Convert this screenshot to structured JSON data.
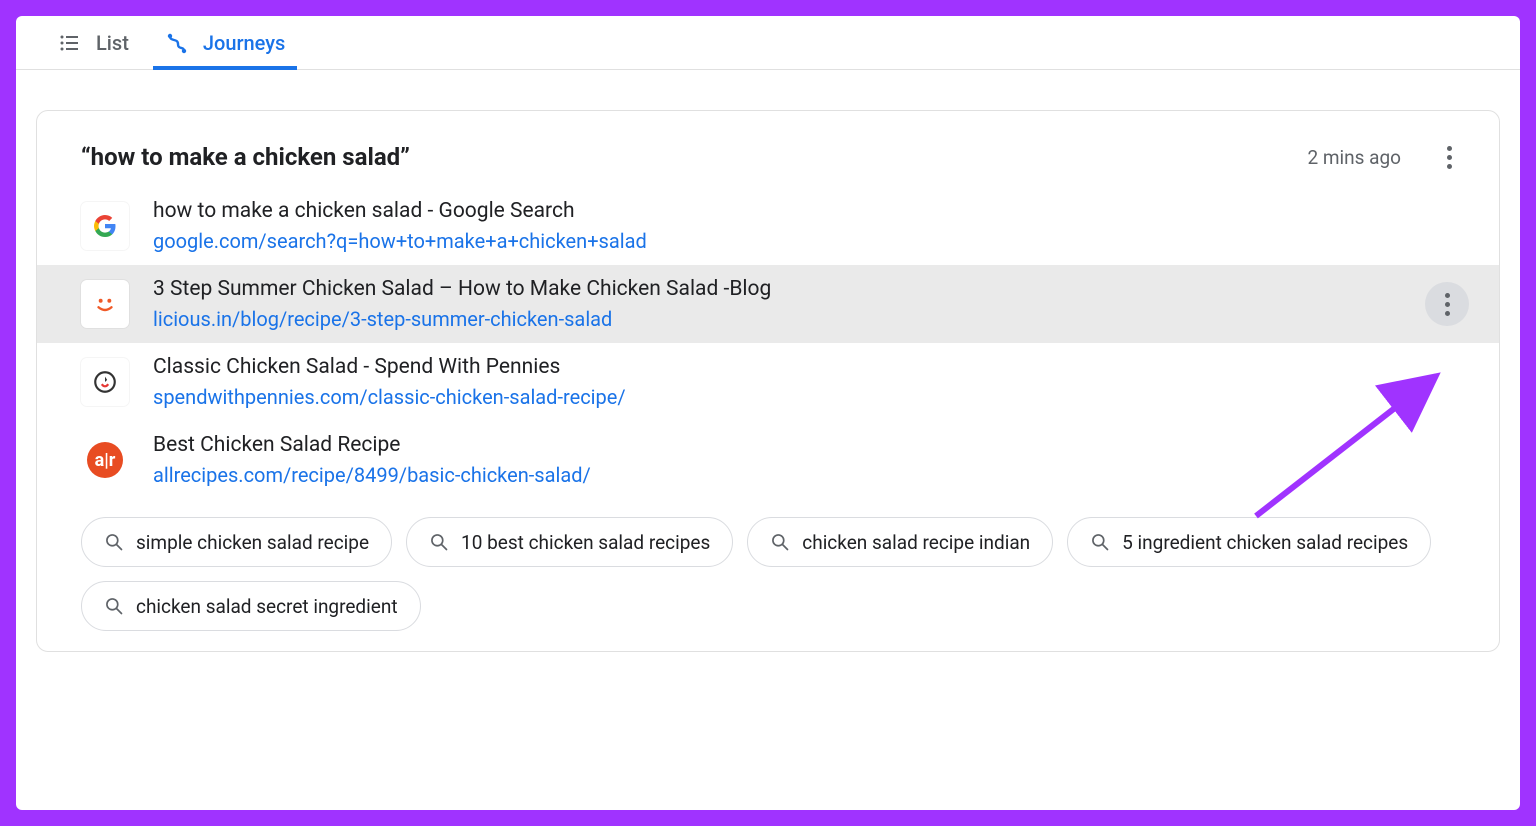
{
  "tabs": {
    "list_label": "List",
    "journeys_label": "Journeys"
  },
  "journey": {
    "query": "“how to make a chicken salad”",
    "timestamp": "2 mins ago",
    "entries": [
      {
        "title": "how to make a chicken salad - Google Search",
        "url": "google.com/search?q=how+to+make+a+chicken+salad",
        "favicon": "google"
      },
      {
        "title": "3 Step Summer Chicken Salad – How to Make Chicken Salad -Blog",
        "url": "licious.in/blog/recipe/3-step-summer-chicken-salad",
        "favicon": "licious",
        "highlighted": true
      },
      {
        "title": "Classic Chicken Salad - Spend With Pennies",
        "url": "spendwithpennies.com/classic-chicken-salad-recipe/",
        "favicon": "swp"
      },
      {
        "title": "Best Chicken Salad Recipe",
        "url": "allrecipes.com/recipe/8499/basic-chicken-salad/",
        "favicon": "allrecipes"
      }
    ],
    "related": [
      "simple chicken salad recipe",
      "10 best chicken salad recipes",
      "chicken salad recipe indian",
      "5 ingredient chicken salad recipes",
      "chicken salad secret ingredient"
    ]
  }
}
